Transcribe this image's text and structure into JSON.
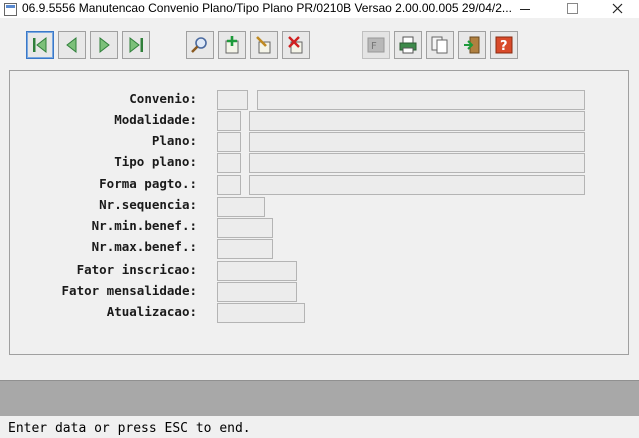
{
  "window": {
    "title": "06.9.5556 Manutencao  Convenio Plano/Tipo Plano PR/0210B Versao 2.00.00.005 29/04/2...",
    "icons": {
      "app": "app-icon",
      "minimize": "minimize-icon",
      "maximize": "maximize-icon",
      "close": "close-icon"
    }
  },
  "toolbar": {
    "buttons": [
      {
        "name": "first-record-button",
        "icon": "first-record-icon"
      },
      {
        "name": "previous-record-button",
        "icon": "previous-record-icon"
      },
      {
        "name": "next-record-button",
        "icon": "next-record-icon"
      },
      {
        "name": "last-record-button",
        "icon": "last-record-icon"
      },
      {
        "name": "search-button",
        "icon": "search-icon"
      },
      {
        "name": "add-button",
        "icon": "add-icon"
      },
      {
        "name": "edit-button",
        "icon": "edit-icon"
      },
      {
        "name": "delete-button",
        "icon": "delete-icon"
      },
      {
        "name": "form-button",
        "icon": "form-icon"
      },
      {
        "name": "print-button",
        "icon": "print-icon"
      },
      {
        "name": "copy-button",
        "icon": "copy-icon"
      },
      {
        "name": "exit-button",
        "icon": "exit-icon"
      },
      {
        "name": "help-button",
        "icon": "help-icon"
      }
    ]
  },
  "form": {
    "labels": {
      "convenio": "Convenio:",
      "modalidade": "Modalidade:",
      "plano": "Plano:",
      "tipo_plano": "Tipo plano:",
      "forma_pagto": "Forma pagto.:",
      "nr_sequencia": "Nr.sequencia:",
      "nr_min_benef": "Nr.min.benef.:",
      "nr_max_benef": "Nr.max.benef.:",
      "fator_inscricao": "Fator inscricao:",
      "fator_mensalidade": "Fator mensalidade:",
      "atualizacao": "Atualizacao:"
    },
    "values": {
      "convenio_code": "",
      "convenio_desc": "",
      "modalidade_code": "",
      "modalidade_desc": "",
      "plano_code": "",
      "plano_desc": "",
      "tipo_plano_code": "",
      "tipo_plano_desc": "",
      "forma_pagto_code": "",
      "forma_pagto_desc": "",
      "nr_sequencia": "",
      "nr_min_benef": "",
      "nr_max_benef": "",
      "fator_inscricao": "",
      "fator_mensalidade": "",
      "atualizacao": ""
    }
  },
  "status": {
    "message": "Enter data or press ESC to end."
  }
}
